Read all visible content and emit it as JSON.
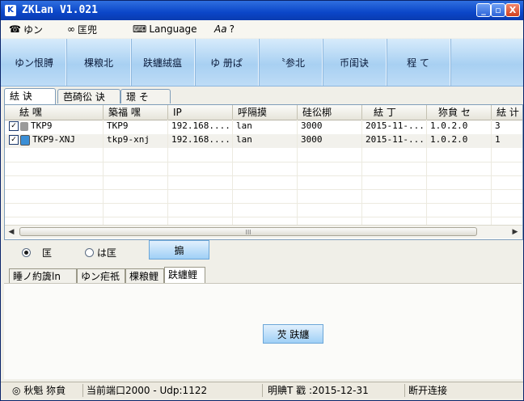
{
  "window": {
    "title": "ZKLan V1.021",
    "icon": "K"
  },
  "title_buttons": {
    "minimize": "_",
    "maximize": "▫",
    "close": "X"
  },
  "menu": [
    {
      "icon": "dial-icon",
      "label": "ゆン"
    },
    {
      "icon": "glasses-icon",
      "label": "匡兜"
    },
    {
      "icon": "keyboard-icon",
      "label": "Language"
    },
    {
      "icon": "help-icon",
      "label": "?"
    }
  ],
  "toolbar": [
    "ゆン恨膊",
    "棵粮北",
    "趺纏絨瘟",
    "ゆ  册ぱ",
    "〝参北",
    "币闺诀",
    "程  て"
  ],
  "tabs": [
    "紶  诀",
    "芭碕彸  诀",
    "璟  そ"
  ],
  "grid": {
    "columns": [
      "紶  嘿",
      "築福  嘿",
      "IP",
      "呼隔摸",
      "硅彸梆",
      "紶  丁",
      "狝貟  セ",
      "紶  计"
    ],
    "rows": [
      {
        "checked": true,
        "icon": "device-icon-gray",
        "cells": [
          "TKP9",
          "TKP9",
          "192.168....",
          "lan",
          "3000",
          "2015-11-...",
          "1.0.2.0",
          "3"
        ]
      },
      {
        "checked": true,
        "icon": "device-icon-monitor",
        "cells": [
          "TKP9-XNJ",
          "tkp9-xnj",
          "192.168....",
          "lan",
          "3000",
          "2015-11-...",
          "1.0.2.0",
          "1"
        ]
      }
    ],
    "scroll_thumb_grip": "III",
    "scroll_left": "◀",
    "scroll_right": "▶"
  },
  "radios": {
    "option1": "匡",
    "option2": "は匡",
    "selected": "option1"
  },
  "action_button": "搧",
  "lower_tabs": [
    "睡ノ約簴ln",
    "ゆン疟祇",
    "棵粮鲤",
    "趺纏鲤"
  ],
  "panel_button": "芡 趺纏",
  "status": {
    "icon": "status-dot-icon",
    "field1": "秋魁  狝貟",
    "field2": "当前端口2000 - Udp:1122",
    "field3": "明賟T  戳 :2015-12-31",
    "field4": "断开连接"
  },
  "colors": {
    "title_bar": "#0b46c8",
    "toolbar": "#a8d0f2",
    "window_bg": "#f0efe8"
  }
}
